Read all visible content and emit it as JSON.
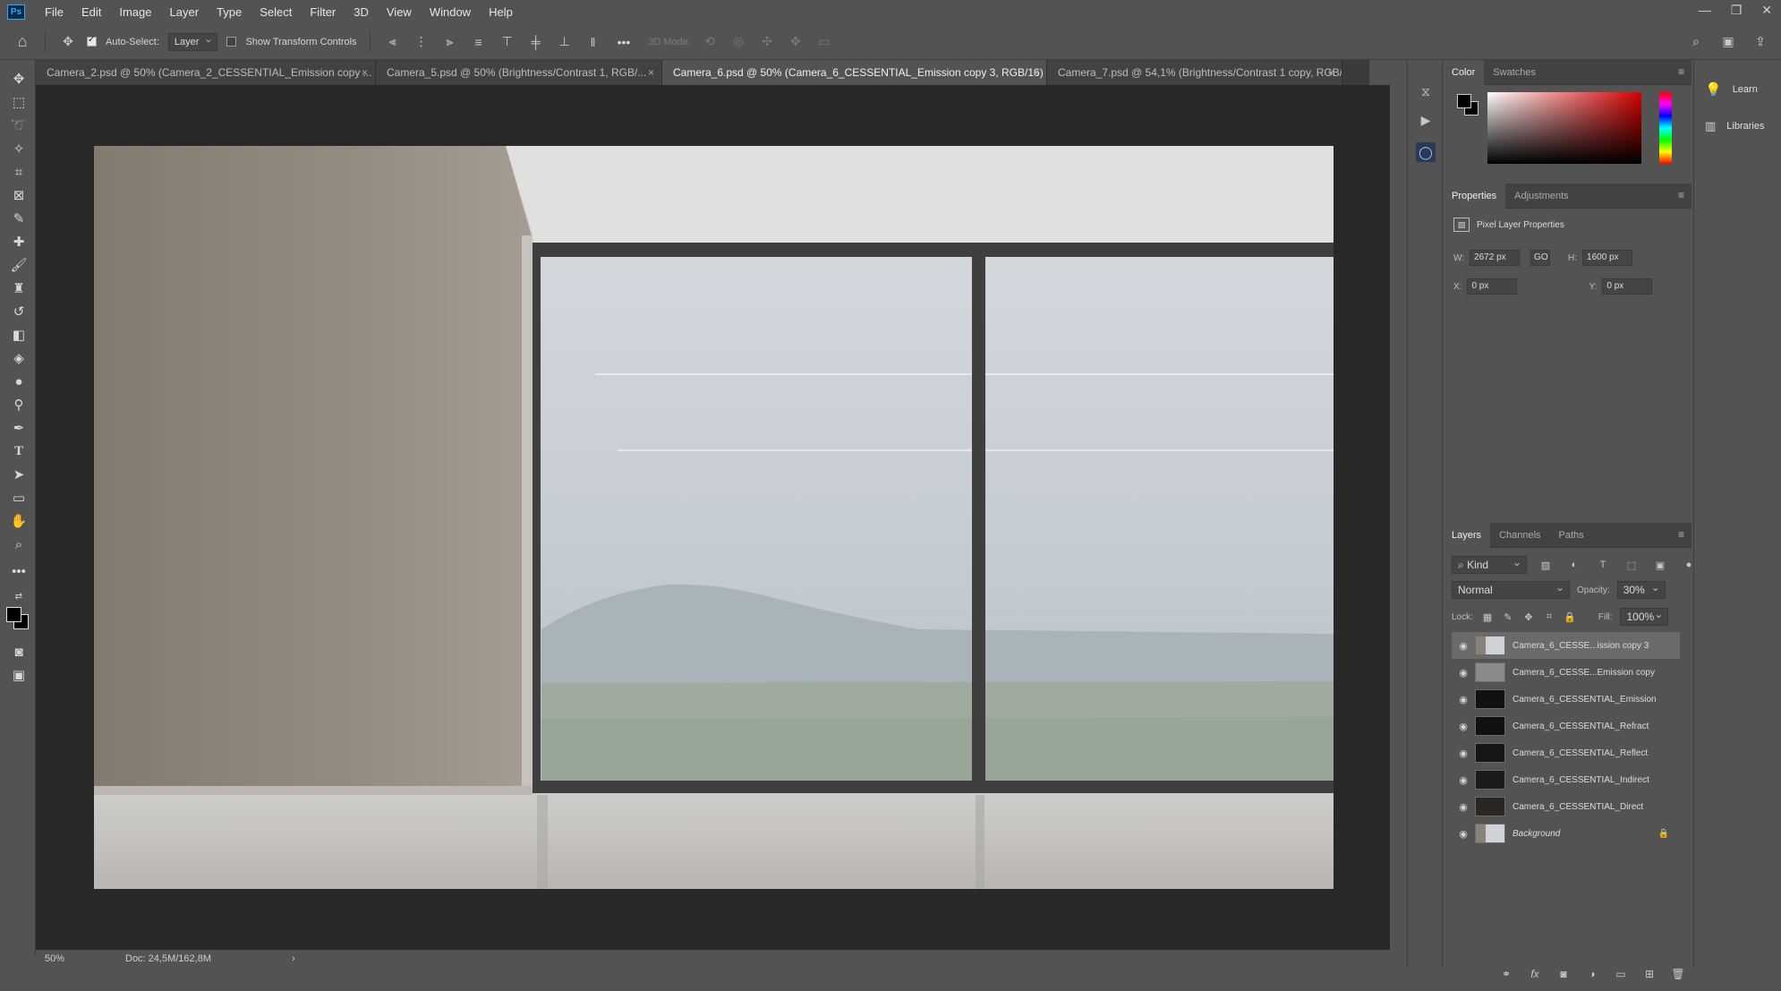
{
  "app": {
    "logo_text": "Ps"
  },
  "menu": [
    "File",
    "Edit",
    "Image",
    "Layer",
    "Type",
    "Select",
    "Filter",
    "3D",
    "View",
    "Window",
    "Help"
  ],
  "window_controls": {
    "minimize": "—",
    "restore": "❐",
    "close": "✕"
  },
  "options_bar": {
    "auto_select_label": "Auto-Select:",
    "auto_select_checked": true,
    "auto_select_target": "Layer",
    "show_transform_label": "Show Transform Controls",
    "show_transform_checked": false,
    "more": "•••",
    "mode_3d_label": "3D Mode:"
  },
  "tabs": [
    {
      "label": "Camera_2.psd @ 50% (Camera_2_CESSENTIAL_Emission copy ...",
      "close": "×",
      "active": false
    },
    {
      "label": "Camera_5.psd @ 50% (Brightness/Contrast 1, RGB/...",
      "close": "×",
      "active": false
    },
    {
      "label": "Camera_6.psd @ 50% (Camera_6_CESSENTIAL_Emission copy 3, RGB/16)",
      "close": "×",
      "active": true
    },
    {
      "label": "Camera_7.psd @ 54,1% (Brightness/Contrast 1 copy, RGB/...",
      "close": "×",
      "active": false
    }
  ],
  "status": {
    "zoom": "50%",
    "doc": "Doc: 24,5M/162,8M",
    "arrow": "›"
  },
  "color_panel": {
    "tabs": [
      "Color",
      "Swatches"
    ],
    "active": "Color",
    "fg": "#000000",
    "bg": "#000000",
    "hue_color": "#cc0000"
  },
  "properties_panel": {
    "tabs": [
      "Properties",
      "Adjustments"
    ],
    "active": "Properties",
    "title": "Pixel Layer Properties",
    "w_label": "W:",
    "w": "2672 px",
    "h_label": "H:",
    "h": "1600 px",
    "x_label": "X:",
    "x": "0 px",
    "y_label": "Y:",
    "y": "0 px",
    "link": "GO"
  },
  "layers_panel": {
    "tabs": [
      "Layers",
      "Channels",
      "Paths"
    ],
    "active": "Layers",
    "kind": "Kind",
    "blend_mode": "Normal",
    "opacity_label": "Opacity:",
    "opacity": "30%",
    "lock_label": "Lock:",
    "fill_label": "Fill:",
    "fill": "100%",
    "layers": [
      {
        "name": "Camera_6_CESSE...ission copy 3",
        "selected": true,
        "italic": false,
        "locked": false
      },
      {
        "name": "Camera_6_CESSE...Emission copy",
        "selected": false,
        "italic": false,
        "locked": false
      },
      {
        "name": "Camera_6_CESSENTIAL_Emission",
        "selected": false,
        "italic": false,
        "locked": false
      },
      {
        "name": "Camera_6_CESSENTIAL_Refract",
        "selected": false,
        "italic": false,
        "locked": false
      },
      {
        "name": "Camera_6_CESSENTIAL_Reflect",
        "selected": false,
        "italic": false,
        "locked": false
      },
      {
        "name": "Camera_6_CESSENTIAL_Indirect",
        "selected": false,
        "italic": false,
        "locked": false
      },
      {
        "name": "Camera_6_CESSENTIAL_Direct",
        "selected": false,
        "italic": false,
        "locked": false
      },
      {
        "name": "Background",
        "selected": false,
        "italic": true,
        "locked": true
      }
    ],
    "footer_icons": [
      "link-icon",
      "fx-icon",
      "mask-icon",
      "adjustment-icon",
      "folder-icon",
      "new-layer-icon",
      "trash-icon"
    ]
  },
  "learn_panel": {
    "learn": "Learn",
    "libraries": "Libraries"
  }
}
